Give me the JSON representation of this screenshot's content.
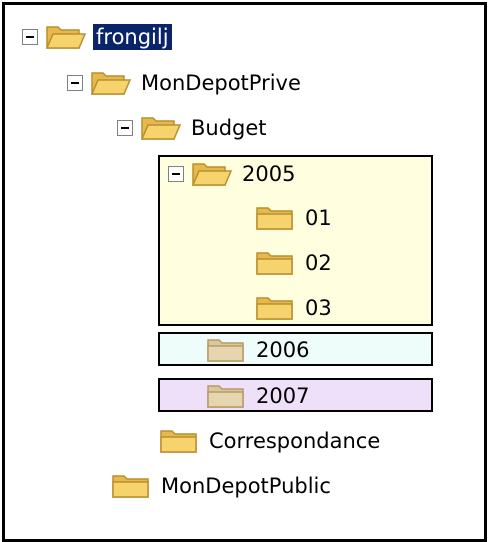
{
  "colors": {
    "selection_bg": "#0a246a",
    "group_2005_bg": "#ffffe0",
    "group_2006_bg": "#eefcfa",
    "group_2007_bg": "#eee0f8",
    "folder_fill": "#f6d36c",
    "folder_stroke": "#b88f2e"
  },
  "tree": {
    "root": {
      "label": "frongilj",
      "expanded": true,
      "selected": true,
      "icon": "folder-open-icon"
    },
    "depot_prive": {
      "label": "MonDepotPrive",
      "expanded": true,
      "icon": "folder-open-icon"
    },
    "budget": {
      "label": "Budget",
      "expanded": true,
      "icon": "folder-open-icon"
    },
    "y2005": {
      "label": "2005",
      "expanded": true,
      "icon": "folder-open-icon"
    },
    "m01": {
      "label": "01",
      "icon": "folder-closed-icon"
    },
    "m02": {
      "label": "02",
      "icon": "folder-closed-icon"
    },
    "m03": {
      "label": "03",
      "icon": "folder-closed-icon"
    },
    "y2006": {
      "label": "2006",
      "icon": "folder-faded-icon"
    },
    "y2007": {
      "label": "2007",
      "icon": "folder-faded-icon"
    },
    "correspondance": {
      "label": "Correspondance",
      "icon": "folder-closed-icon"
    },
    "depot_public": {
      "label": "MonDepotPublic",
      "icon": "folder-closed-icon"
    }
  }
}
